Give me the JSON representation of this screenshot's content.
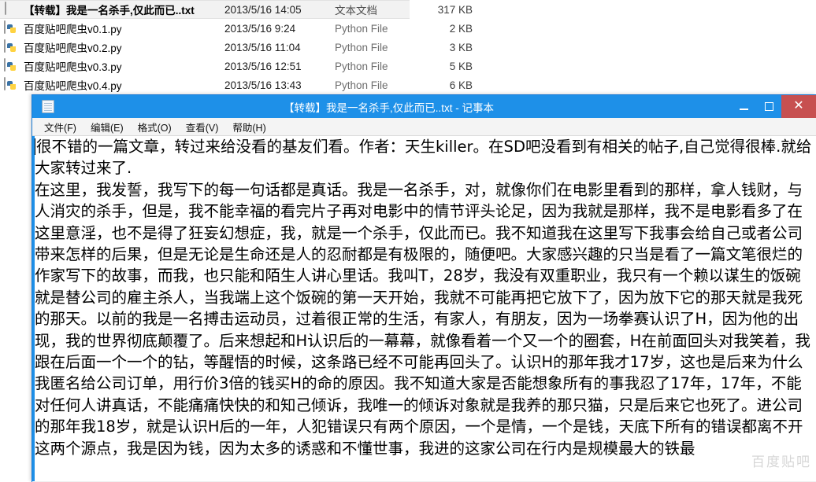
{
  "explorer": {
    "files": [
      {
        "icon": "text-document-icon",
        "name": "【转载】我是一名杀手,仅此而已..txt",
        "date": "2013/5/16 14:05",
        "type": "文本文档",
        "size": "317 KB",
        "selected": true
      },
      {
        "icon": "python-file-icon",
        "name": "百度贴吧爬虫v0.1.py",
        "date": "2013/5/16 9:24",
        "type": "Python File",
        "size": "2 KB",
        "selected": false
      },
      {
        "icon": "python-file-icon",
        "name": "百度贴吧爬虫v0.2.py",
        "date": "2013/5/16 11:04",
        "type": "Python File",
        "size": "3 KB",
        "selected": false
      },
      {
        "icon": "python-file-icon",
        "name": "百度贴吧爬虫v0.3.py",
        "date": "2013/5/16 12:51",
        "type": "Python File",
        "size": "5 KB",
        "selected": false
      },
      {
        "icon": "python-file-icon",
        "name": "百度贴吧爬虫v0.4.py",
        "date": "2013/5/16 13:43",
        "type": "Python File",
        "size": "6 KB",
        "selected": false
      }
    ]
  },
  "notepad": {
    "icon": "notepad-icon",
    "title": "【转载】我是一名杀手,仅此而已..txt - 记事本",
    "window_buttons": {
      "minimize": "minimize-icon",
      "maximize": "maximize-icon",
      "close": "✕"
    },
    "menu": [
      {
        "label": "文件(F)"
      },
      {
        "label": "编辑(E)"
      },
      {
        "label": "格式(O)"
      },
      {
        "label": "查看(V)"
      },
      {
        "label": "帮助(H)"
      }
    ],
    "content": "很不错的一篇文章，转过来给没看的基友们看。作者：天生killer。在SD吧没看到有相关的帖子,自己觉得很棒.就给大家转过来了.\n在这里，我发誓，我写下的每一句话都是真话。我是一名杀手，对，就像你们在电影里看到的那样，拿人钱财，与人消灾的杀手，但是，我不能幸福的看完片子再对电影中的情节评头论足，因为我就是那样，我不是电影看多了在这里意淫，也不是得了狂妄幻想症，我，就是一个杀手，仅此而已。我不知道我在这里写下我事会给自己或者公司带来怎样的后果，但是无论是生命还是人的忍耐都是有极限的，随便吧。大家感兴趣的只当是看了一篇文笔很烂的作家写下的故事，而我，也只能和陌生人讲心里话。我叫T，28岁，我没有双重职业，我只有一个赖以谋生的饭碗就是替公司的雇主杀人，当我端上这个饭碗的第一天开始，我就不可能再把它放下了，因为放下它的那天就是我死的那天。以前的我是一名搏击运动员，过着很正常的生活，有家人，有朋友，因为一场拳赛认识了H，因为他的出现，我的世界彻底颠覆了。后来想起和H认识后的一幕幕，就像看着一个又一个的圈套，H在前面回头对我笑着，我跟在后面一个一个的钻，等醒悟的时候，这条路已经不可能再回头了。认识H的那年我才17岁，这也是后来为什么我匿名给公司订单，用行价3倍的钱买H的命的原因。我不知道大家是否能想象所有的事我忍了17年，17年，不能对任何人讲真话，不能痛痛快快的和知己倾诉，我唯一的倾诉对象就是我养的那只猫，只是后来它也死了。进公司的那年我18岁，就是认识H后的一年，人犯错误只有两个原因，一个是情，一个是钱，天底下所有的错误都离不开这两个源点，我是因为钱，因为太多的诱惑和不懂世事，我进的这家公司在行内是规模最大的铁最",
    "watermark": "百度贴吧"
  }
}
